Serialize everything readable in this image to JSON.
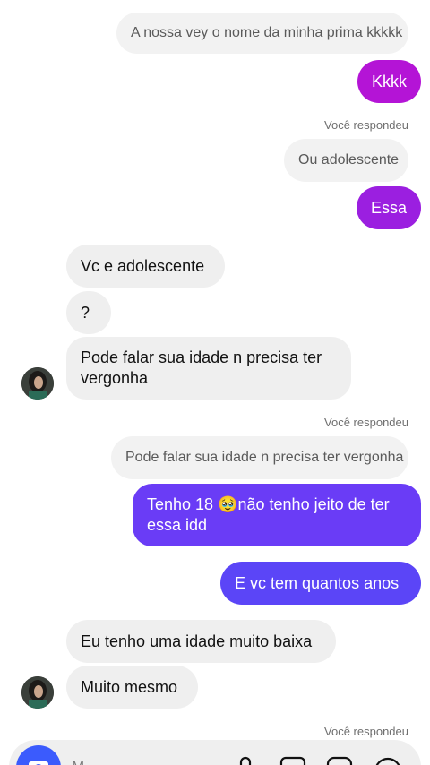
{
  "messages": {
    "reply_quote_1": "A nossa vey o nome da minha prima kkkkk",
    "out_1": "Kkkk",
    "replied_note_1": "Você respondeu",
    "reply_quote_2": "Ou adolescente",
    "out_2": "Essa",
    "in_1": "Vc e adolescente",
    "in_2": "?",
    "in_3_line1": "Pode falar sua idade n precisa ter",
    "in_3_line2": "vergonha",
    "replied_note_2": "Você respondeu",
    "reply_quote_3": "Pode falar sua idade n precisa ter vergonha",
    "out_3_line1_a": "Tenho 18 ",
    "out_3_emoji": "🥹",
    "out_3_line1_b": "não tenho jeito de ter",
    "out_3_line2": "essa idd",
    "out_4": "E vc tem quantos anos",
    "in_4": "Eu tenho uma idade muito baixa",
    "in_5": "Muito mesmo",
    "replied_note_3": "Você respondeu"
  },
  "composer": {
    "placeholder": "M..."
  },
  "colors": {
    "bubble_magenta": "#b414d6",
    "bubble_purple": "#9b1fe0",
    "bubble_violet": "#6a3cf6",
    "bubble_indigo": "#5b45f7",
    "camera_blue": "#3b5bfd"
  }
}
